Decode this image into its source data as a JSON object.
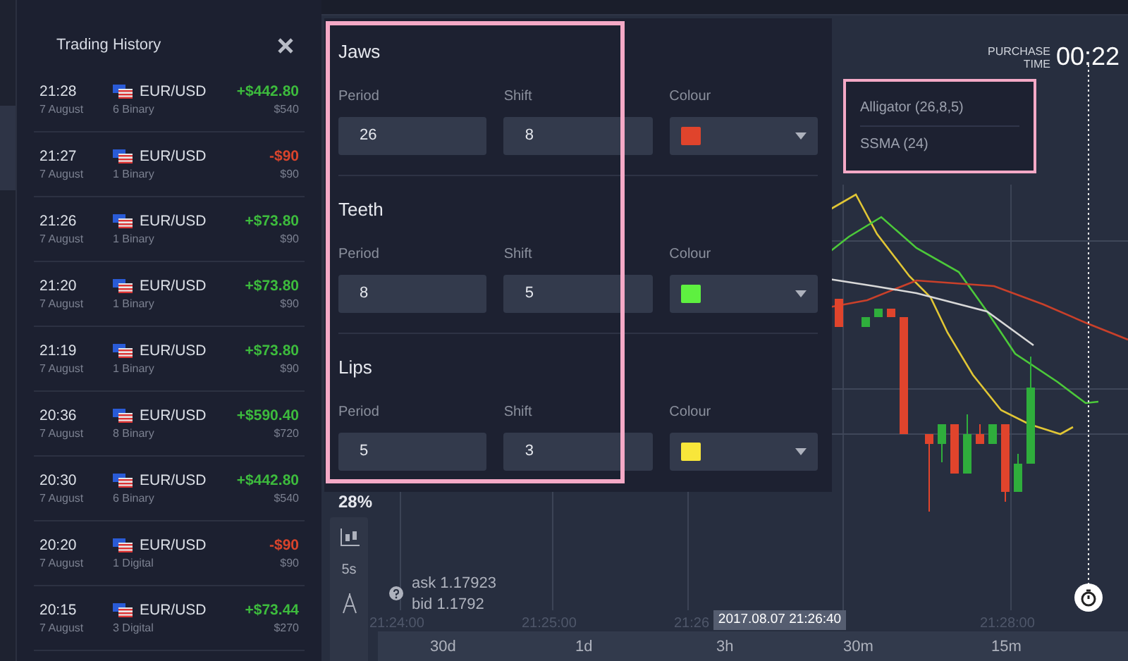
{
  "history": {
    "title": "Trading History",
    "rows": [
      {
        "time": "21:28",
        "date": "7 August",
        "pair": "EUR/USD",
        "deal": "6 Binary",
        "profit": "+$442.80",
        "kind": "gain",
        "amount": "$540"
      },
      {
        "time": "21:27",
        "date": "7 August",
        "pair": "EUR/USD",
        "deal": "1 Binary",
        "profit": "-$90",
        "kind": "loss",
        "amount": "$90"
      },
      {
        "time": "21:26",
        "date": "7 August",
        "pair": "EUR/USD",
        "deal": "1 Binary",
        "profit": "+$73.80",
        "kind": "gain",
        "amount": "$90"
      },
      {
        "time": "21:20",
        "date": "7 August",
        "pair": "EUR/USD",
        "deal": "1 Binary",
        "profit": "+$73.80",
        "kind": "gain",
        "amount": "$90"
      },
      {
        "time": "21:19",
        "date": "7 August",
        "pair": "EUR/USD",
        "deal": "1 Binary",
        "profit": "+$73.80",
        "kind": "gain",
        "amount": "$90"
      },
      {
        "time": "20:36",
        "date": "7 August",
        "pair": "EUR/USD",
        "deal": "8 Binary",
        "profit": "+$590.40",
        "kind": "gain",
        "amount": "$720"
      },
      {
        "time": "20:30",
        "date": "7 August",
        "pair": "EUR/USD",
        "deal": "6 Binary",
        "profit": "+$442.80",
        "kind": "gain",
        "amount": "$540"
      },
      {
        "time": "20:20",
        "date": "7 August",
        "pair": "EUR/USD",
        "deal": "1 Digital",
        "profit": "-$90",
        "kind": "loss",
        "amount": "$90"
      },
      {
        "time": "20:15",
        "date": "7 August",
        "pair": "EUR/USD",
        "deal": "3 Digital",
        "profit": "+$73.44",
        "kind": "gain",
        "amount": "$270"
      }
    ]
  },
  "settings": {
    "sections": [
      {
        "title": "Jaws",
        "fields": [
          {
            "label": "Period",
            "value": "26"
          },
          {
            "label": "Shift",
            "value": "8"
          }
        ],
        "colour_label": "Colour",
        "color": "#e0442c"
      },
      {
        "title": "Teeth",
        "fields": [
          {
            "label": "Period",
            "value": "8"
          },
          {
            "label": "Shift",
            "value": "5"
          }
        ],
        "colour_label": "Colour",
        "color": "#5ef040"
      },
      {
        "title": "Lips",
        "fields": [
          {
            "label": "Period",
            "value": "5"
          },
          {
            "label": "Shift",
            "value": "3"
          }
        ],
        "colour_label": "Colour",
        "color": "#f8e63a"
      }
    ]
  },
  "indicators": [
    "Alligator (26,8,5)",
    "SSMA (24)"
  ],
  "purchase": {
    "label_top": "PURCHASE",
    "label_bottom": "TIME",
    "timer": "00:22"
  },
  "chart": {
    "percent": "28%",
    "ask": "ask 1.17923",
    "bid": "bid 1.1792",
    "interval": "5s",
    "time_labels": [
      "21:24:00",
      "21:25:00",
      "21:26",
      "21:28:00"
    ],
    "cursor_time": "2017.08.07 21:26:40",
    "periods": [
      "30d",
      "1d",
      "3h",
      "30m",
      "15m"
    ]
  }
}
